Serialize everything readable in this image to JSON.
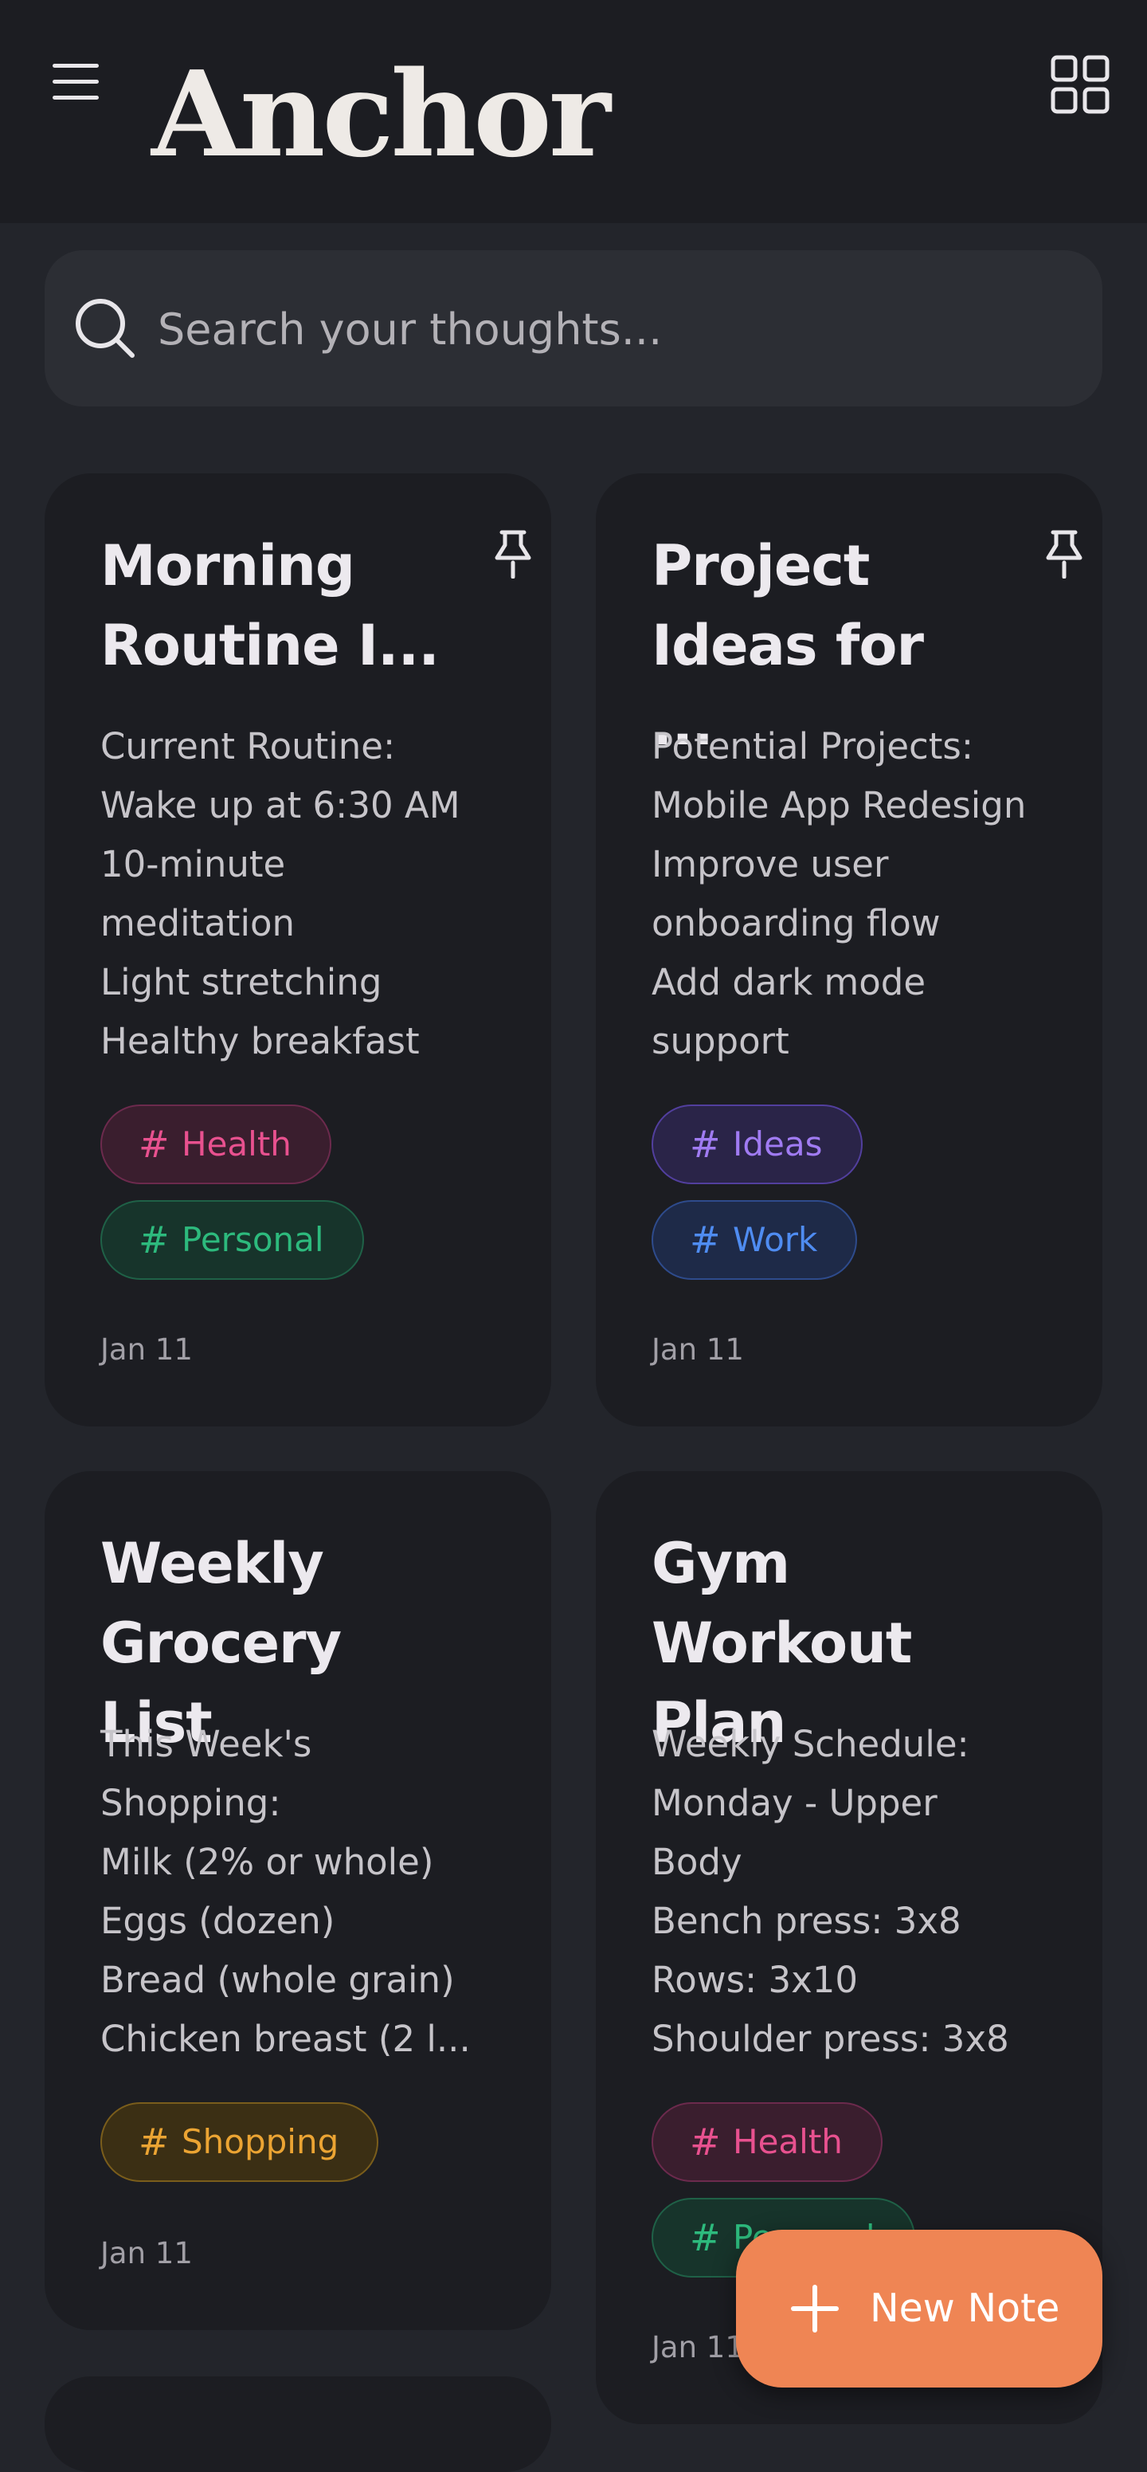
{
  "app": {
    "title": "Anchor"
  },
  "search": {
    "placeholder": "Search your thoughts..."
  },
  "notes": [
    {
      "title": "Morning\nRoutine I...",
      "body": "Current Routine:\nWake up at 6:30 AM\n10-minute\nmeditation\nLight stretching\nHealthy breakfast",
      "pinned": true,
      "tags": [
        "Health",
        "Personal"
      ],
      "date": "Jan 11"
    },
    {
      "title": "Project\nIdeas for ...",
      "body": "Potential Projects:\nMobile App Redesign\nImprove user\nonboarding flow\nAdd dark mode\nsupport",
      "pinned": true,
      "tags": [
        "Ideas",
        "Work"
      ],
      "date": "Jan 11"
    },
    {
      "title": "Weekly\nGrocery List",
      "body": "This Week's\nShopping:\nMilk (2% or whole)\nEggs (dozen)\nBread (whole grain)\nChicken breast (2 l...",
      "pinned": false,
      "tags": [
        "Shopping"
      ],
      "date": "Jan 11"
    },
    {
      "title": "Gym\nWorkout Plan",
      "body": "Weekly Schedule:\nMonday - Upper\nBody\nBench press: 3x8\nRows: 3x10\nShoulder press: 3x8",
      "pinned": false,
      "tags": [
        "Health",
        "Personal"
      ],
      "date": "Jan 11"
    }
  ],
  "tag_prefix": "#",
  "fab": {
    "label": "New Note"
  },
  "colors": {
    "background": "#23252b",
    "card": "#1c1d22",
    "accent": "#ef8554",
    "health": "#e8518f",
    "personal": "#2dba7d",
    "ideas": "#a07bf2",
    "work": "#4f8cf1",
    "shopping": "#eba433"
  },
  "icons": {
    "menu": "hamburger-menu-icon",
    "layout": "grid-view-icon",
    "search": "search-icon",
    "pin": "pin-icon",
    "add": "plus-icon"
  }
}
